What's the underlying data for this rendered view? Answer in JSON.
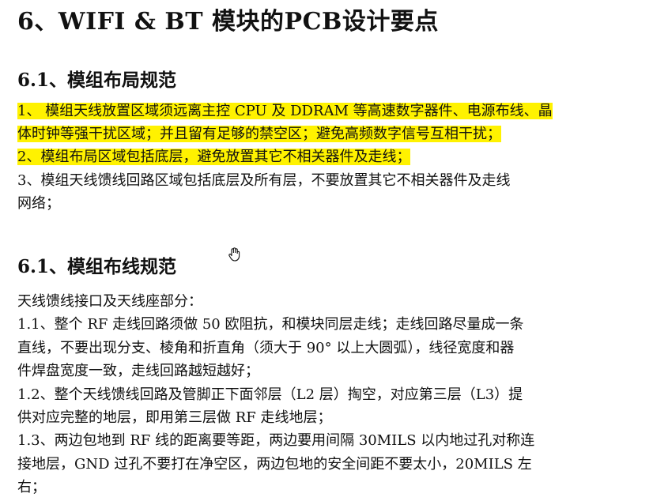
{
  "doc": {
    "title": "6、WIFI & BT 模块的PCB设计要点",
    "section1": {
      "heading": "6.1、模组布局规范",
      "lines": [
        "1、 模组天线放置区域须远离主控 CPU 及 DDRAM 等高速数字器件、电源布线、晶",
        "体时钟等强干扰区域；并且留有足够的禁空区；避免高频数字信号互相干扰；",
        "2、模组布局区域包括底层，避免放置其它不相关器件及走线；",
        "3、模组天线馈线回路区域包括底层及所有层，不要放置其它不相关器件及走线",
        "网络；"
      ]
    },
    "section2": {
      "heading": "6.1、模组布线规范",
      "lines": [
        "天线馈线接口及天线座部分：",
        "1.1、整个 RF 走线回路须做 50 欧阻抗，和模块同层走线；走线回路尽量成一条",
        "直线，不要出现分支、棱角和折直角（须大于 90° 以上大圆弧），线径宽度和器",
        "件焊盘宽度一致，走线回路越短越好；",
        "1.2、整个天线馈线回路及管脚正下面邻层（L2 层）掏空，对应第三层（L3）提",
        "供对应完整的地层，即用第三层做 RF 走线地层；",
        "1.3、两边包地到 RF 线的距离要等距，两边要用间隔 30MILS 以内地过孔对称连",
        "接地层，GND 过孔不要打在净空区，两边包地的安全间距不要太小，20MILS 左",
        "右；"
      ]
    },
    "highlight_color": "#fff200",
    "cursor_icon": "hand-pointer-icon"
  }
}
